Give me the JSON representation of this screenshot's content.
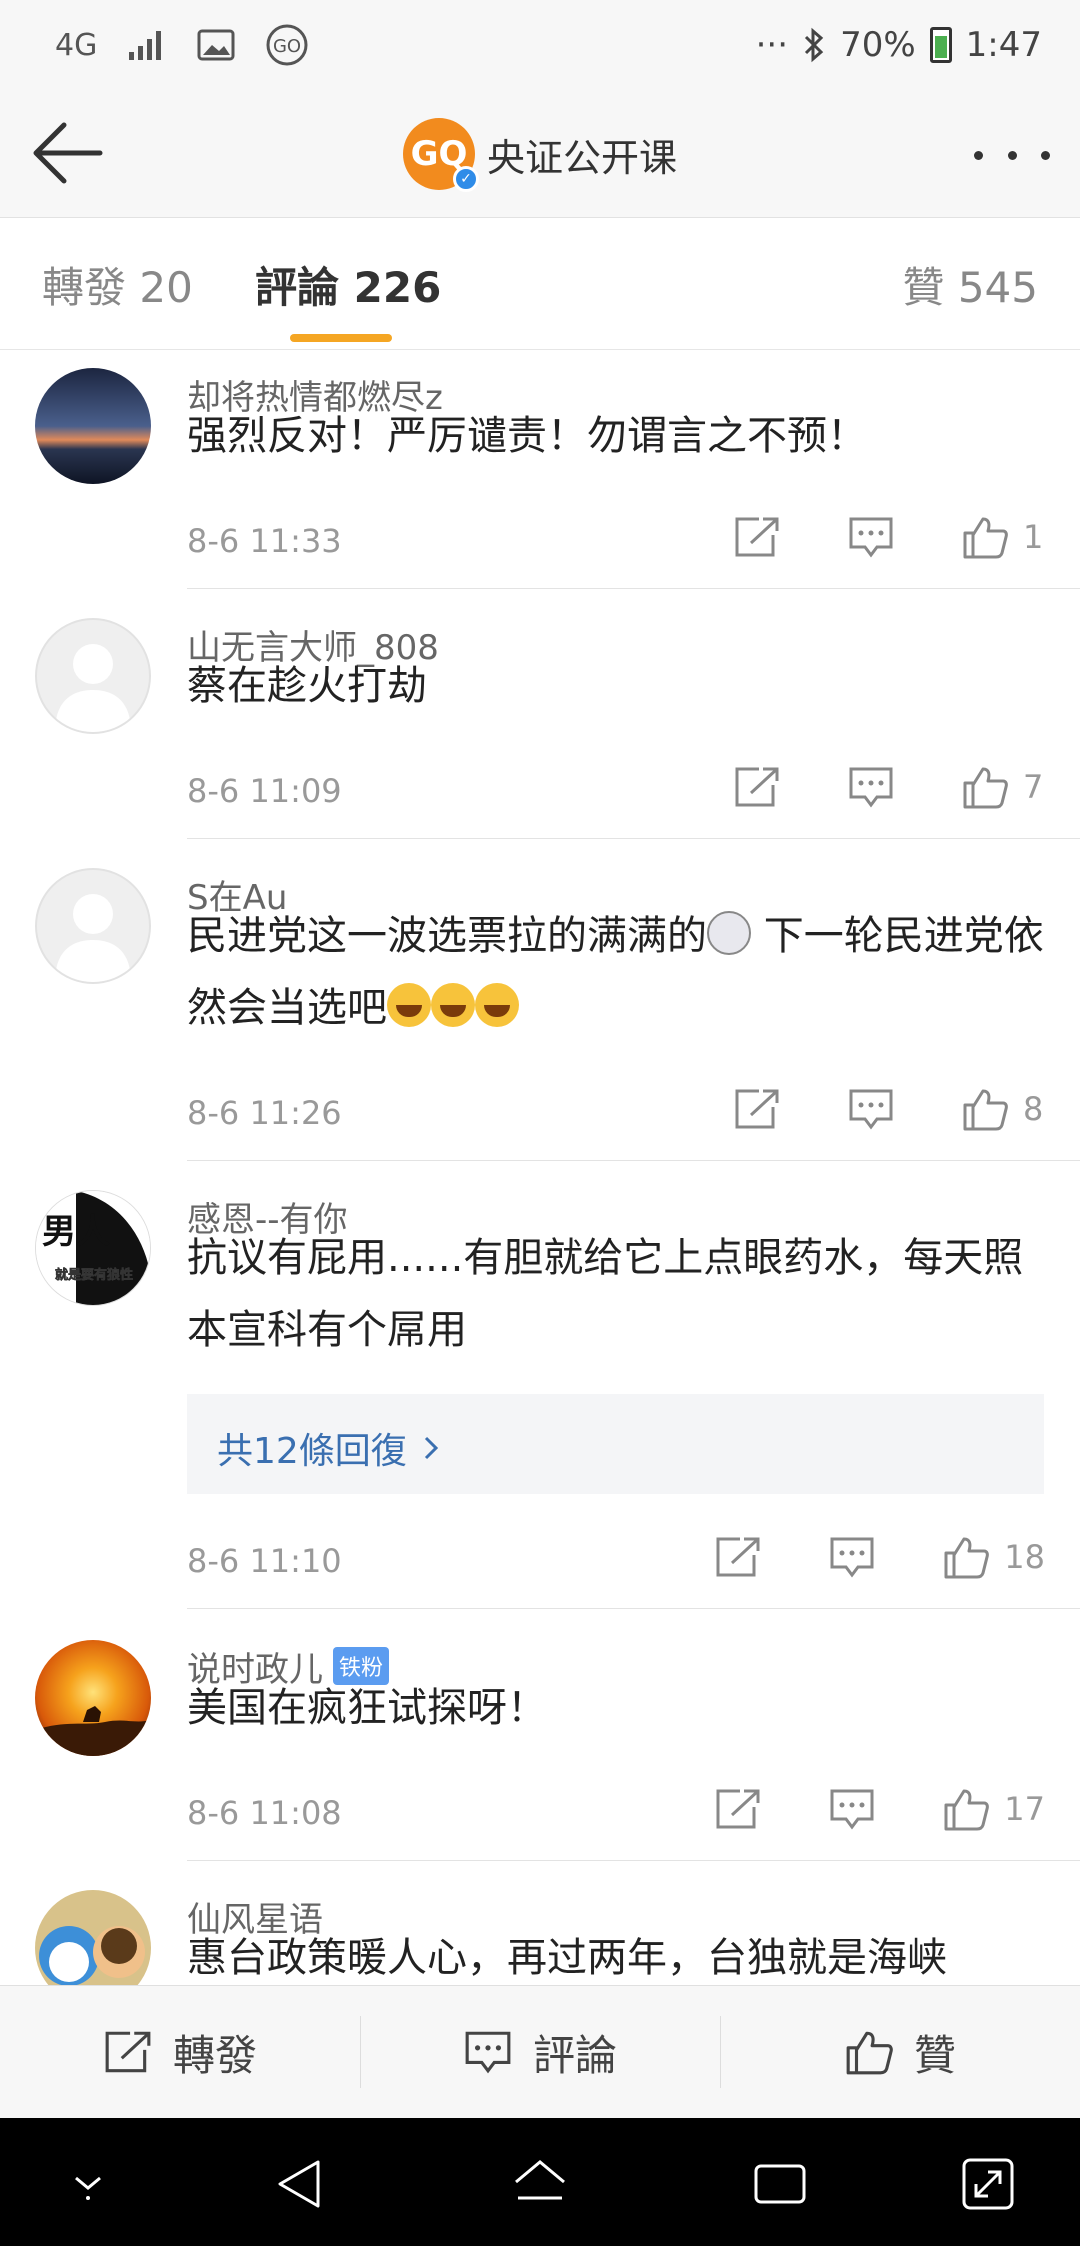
{
  "status_bar": {
    "network": "4G",
    "battery": "70%",
    "time": "1:47",
    "more": "···",
    "icons": [
      "4g-icon",
      "signal-icon",
      "image-icon",
      "go-icon",
      "bluetooth-icon",
      "battery-icon"
    ]
  },
  "nav": {
    "title": "央证公开课",
    "logo_text": "GQ",
    "icons": [
      "back-arrow-icon",
      "verified-icon",
      "more-dots-icon"
    ]
  },
  "tabs": {
    "repost": "轉發 20",
    "comment": "評論 226",
    "like": "贊 545",
    "active": "comment",
    "indicator_color": "#f5a623"
  },
  "comments": [
    {
      "user": "却将热情都燃尽z",
      "text": "强烈反对！严厉谴责！勿谓言之不预！",
      "time": "8-6 11:33",
      "likes": "1"
    },
    {
      "user": "山无言大师_808",
      "text": "蔡在趁火打劫",
      "time": "8-6 11:09",
      "likes": "7"
    },
    {
      "user": "S在Au",
      "text_part1": "民进党这一波选票拉的满满的",
      "text_part2": " 下一轮民进党依然会当选吧",
      "time": "8-6 11:26",
      "likes": "8"
    },
    {
      "user": "感恩--有你",
      "text": "抗议有屁用......有胆就给它上点眼药水，每天照本宣科有个屌用",
      "replies": "共12條回復",
      "avatar_text_1": "男人",
      "avatar_text_2": "就是要有狼性",
      "time": "8-6 11:10",
      "likes": "18"
    },
    {
      "user": "说时政儿",
      "badge": "铁粉",
      "text": "美国在疯狂试探呀！",
      "time": "8-6 11:08",
      "likes": "17"
    },
    {
      "user": "仙风星语",
      "text": "惠台政策暖人心，再过两年，台独就是海峡"
    }
  ],
  "bottom_bar": {
    "repost": "轉發",
    "comment": "評論",
    "like": "贊"
  },
  "colors": {
    "accent": "#f5a623",
    "link": "#3a6fb0",
    "badge": "#5b9cf0",
    "logo": "#f28b1e"
  }
}
